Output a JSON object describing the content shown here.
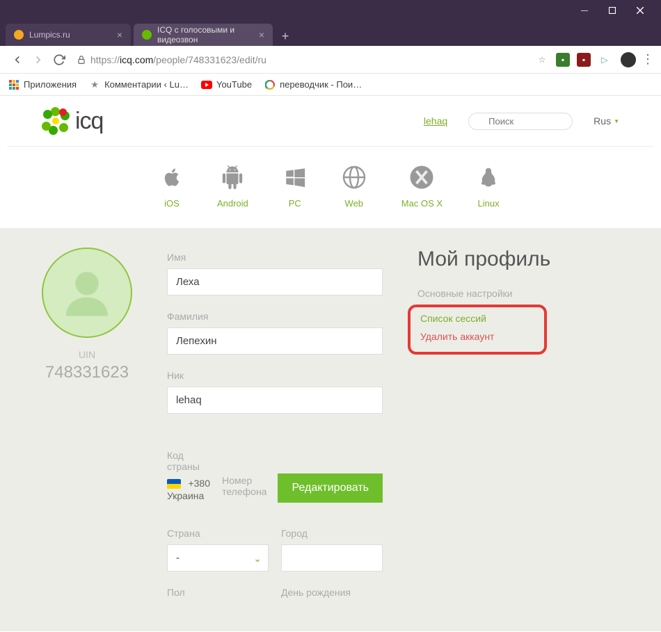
{
  "browser": {
    "tabs": [
      {
        "title": "Lumpics.ru"
      },
      {
        "title": "ICQ с голосовыми и видеозвон"
      }
    ],
    "url": {
      "proto": "https://",
      "domain": "icq.com",
      "path": "/people/748331623/edit/ru"
    },
    "bookmarks": {
      "apps": "Приложения",
      "comments": "Комментарии ‹ Lu…",
      "youtube": "YouTube",
      "translator": "переводчик - Пои…"
    }
  },
  "header": {
    "logo": "icq",
    "user": "lehaq",
    "search_placeholder": "Поиск",
    "lang": "Rus"
  },
  "platforms": {
    "ios": "iOS",
    "android": "Android",
    "pc": "PC",
    "web": "Web",
    "mac": "Mac OS X",
    "linux": "Linux"
  },
  "profile": {
    "uin_label": "UIN",
    "uin_value": "748331623",
    "name_label": "Имя",
    "name_value": "Леха",
    "surname_label": "Фамилия",
    "surname_value": "Лепехин",
    "nick_label": "Ник",
    "nick_value": "lehaq",
    "country_code_label": "Код страны",
    "country_code_value": "+380 Украина",
    "phone_label": "Номер телефона",
    "phone_value": " ",
    "edit_btn": "Редактировать",
    "country_label": "Страна",
    "country_value": "-",
    "city_label": "Город",
    "city_value": "",
    "gender_label": "Пол",
    "dob_label": "День рождения"
  },
  "sidebar": {
    "title": "Мой профиль",
    "settings_label": "Основные настройки",
    "sessions": "Список сессий",
    "delete": "Удалить аккаунт"
  }
}
